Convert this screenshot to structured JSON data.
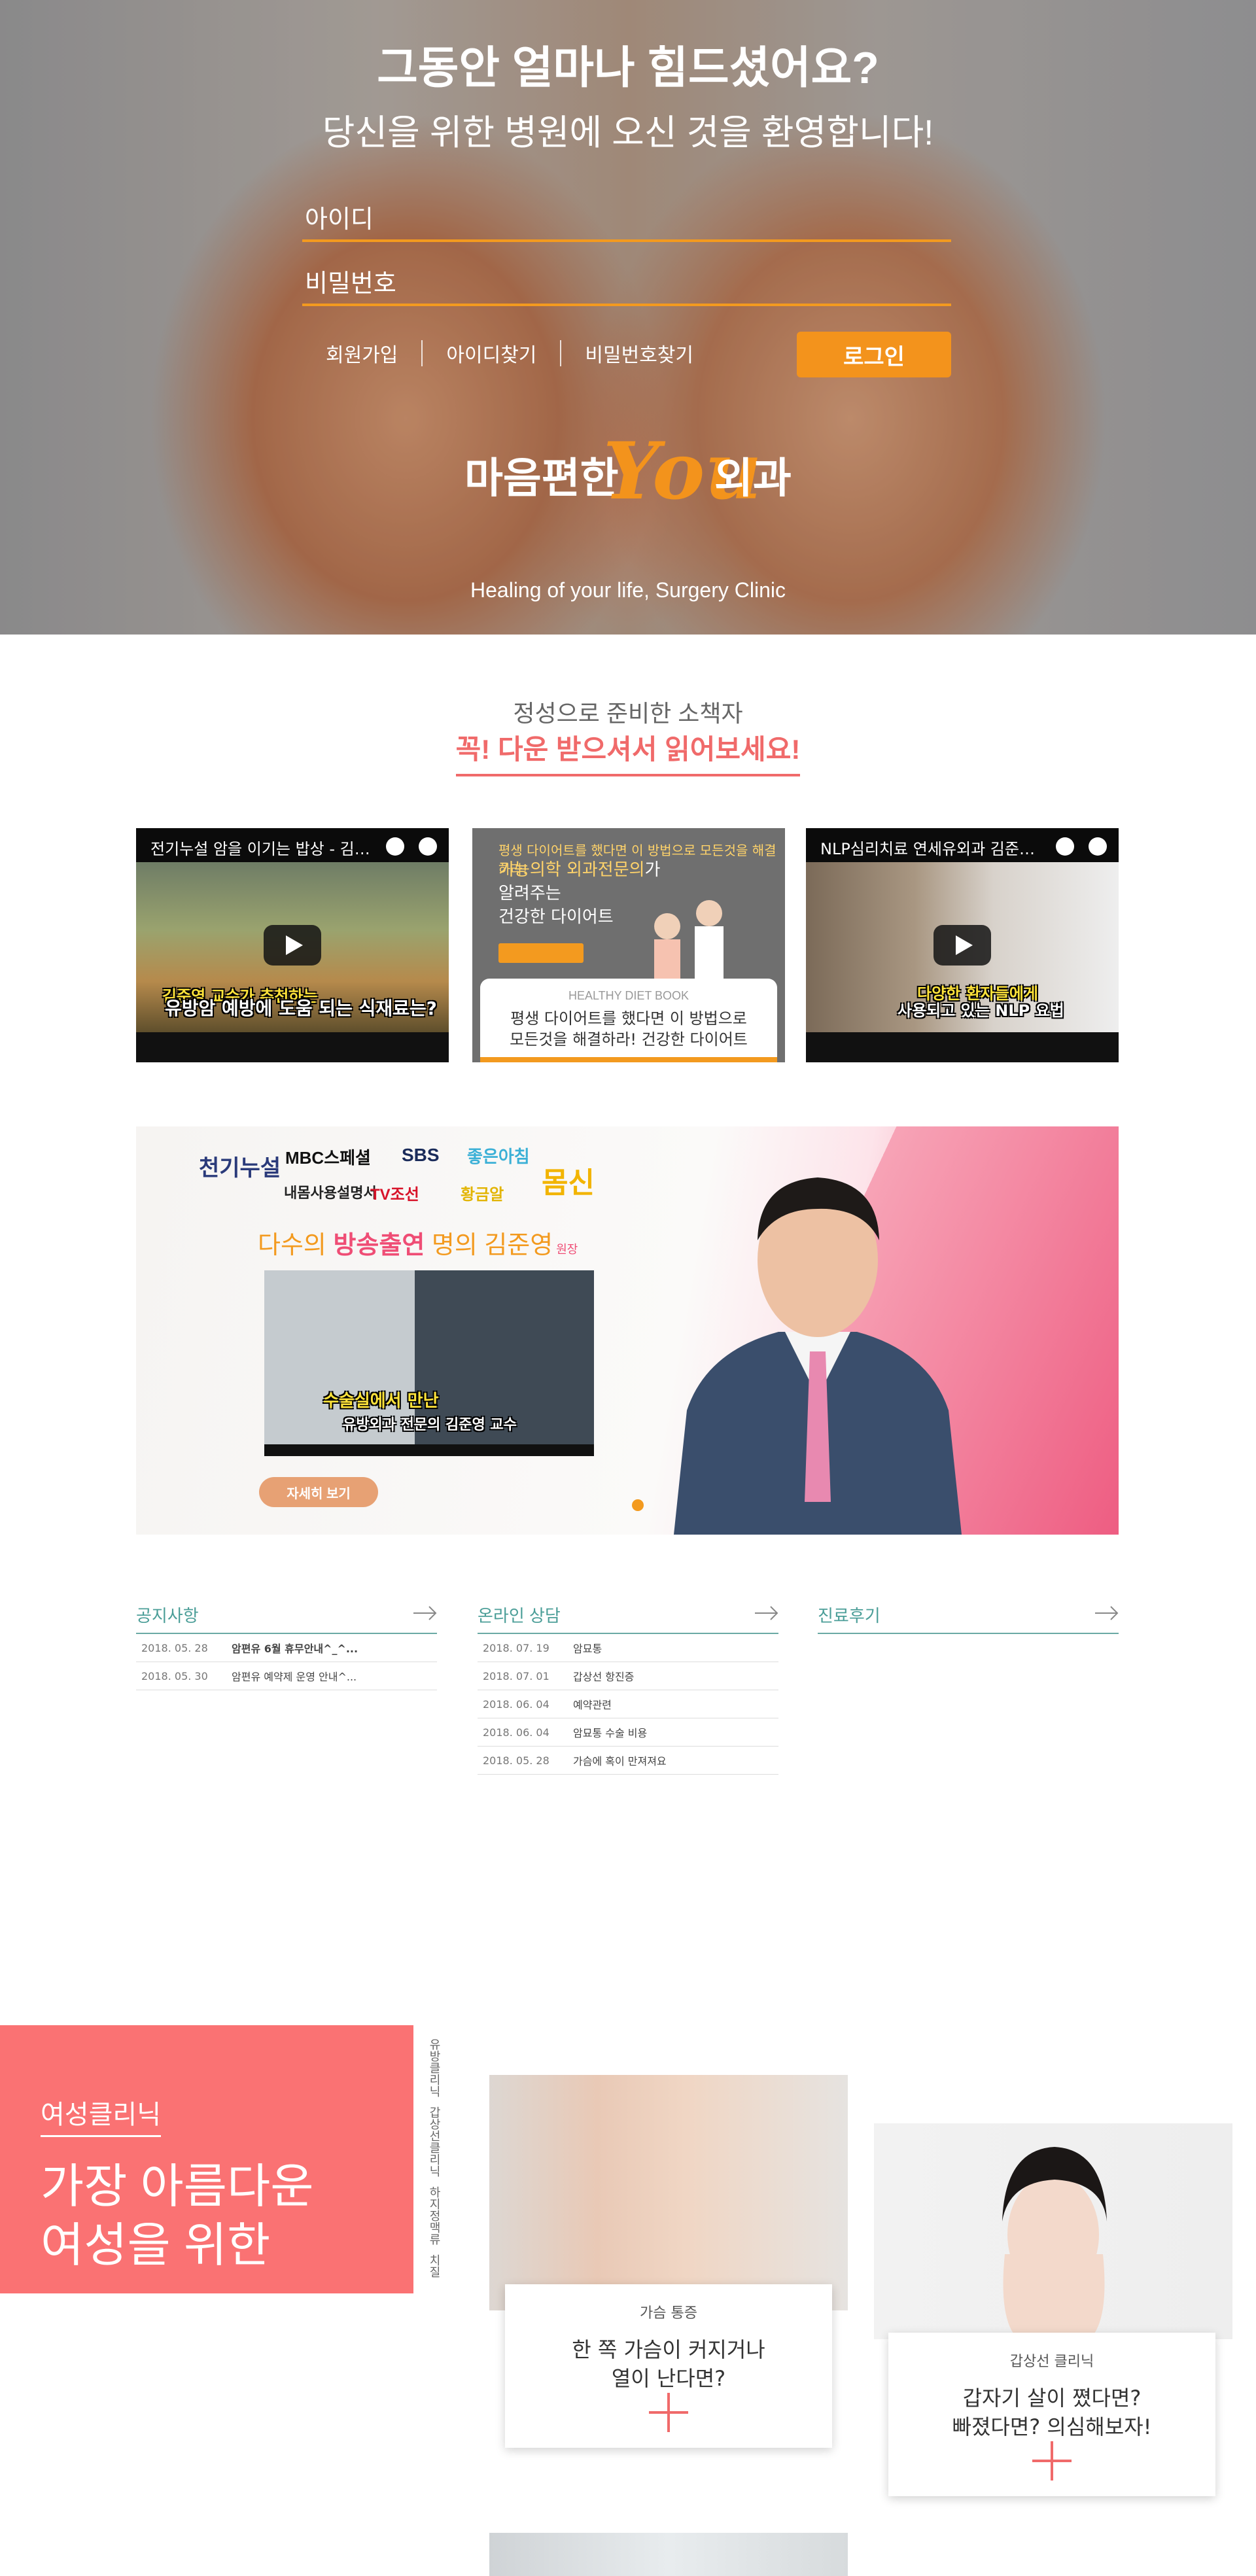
{
  "hero": {
    "title": "그동안 얼마나 힘드셨어요?",
    "subtitle": "당신을 위한 병원에 오신 것을 환영합니다!",
    "id_placeholder": "아이디",
    "pw_placeholder": "비밀번호",
    "links": [
      "회원가입",
      "아이디찾기",
      "비밀번호찾기"
    ],
    "login_label": "로그인",
    "logo": {
      "part1": "마음편한",
      "part2": "You",
      "part3": "외과"
    },
    "tagline": "Healing of your life, Surgery Clinic",
    "accent": "#f3931c"
  },
  "books": {
    "eyebrow": "정성으로 준비한 소책자",
    "title": "꼭! 다운 받으셔서 읽어보세요!",
    "video1": {
      "title": "전기누설 암을 이기는 밥상 - 김준...",
      "caption1": "김준영 교수가 추천하는",
      "caption2": "유방암 예방에 도움 되는 식재료는?"
    },
    "book": {
      "head": "평생 다이어트를 했다면 이 방법으로 모든것을 해결하라!",
      "title1": "기능의학 외과전문의",
      "title1b": "가",
      "title2": "알려주는",
      "title3": "건강한 다이어트",
      "panel_small": "HEALTHY DIET BOOK",
      "panel_line1": "평생 다이어트를 했다면 이 방법으로",
      "panel_line2": "모든것을 해결하라! 건강한 다이어트"
    },
    "video2": {
      "title": "NLP심리치료 연세유외과 김준영...",
      "caption1": "다양한 환자들에게",
      "caption2": "사용되고 있는 NLP 요법"
    }
  },
  "banner": {
    "logos": [
      "천기누설",
      "MBC스페셜",
      "SBS",
      "좋은아침",
      "내몸사용설명서",
      "TV조선",
      "황금알",
      "몸신"
    ],
    "head_a": "다수의 ",
    "head_b": "방송출연",
    "head_c": " 명의 김준영",
    "head_d": " 원장",
    "video_caption1": "수술실에서 만난",
    "video_caption2": "유방외과 전문의 김준영 교수",
    "button": "자세히 보기"
  },
  "boards": {
    "notice": {
      "title": "공지사항",
      "rows": [
        {
          "date": "2018. 05. 28",
          "text": "암편유 6월 휴무안내^_^...",
          "bold": true
        },
        {
          "date": "2018. 05. 30",
          "text": "암편유 예약제 운영 안내^...",
          "bold": false
        }
      ]
    },
    "consult": {
      "title": "온라인 상담",
      "rows": [
        {
          "date": "2018. 07. 19",
          "text": "암묘통"
        },
        {
          "date": "2018. 07. 01",
          "text": "갑상선 항진증"
        },
        {
          "date": "2018. 06. 04",
          "text": "예약관련"
        },
        {
          "date": "2018. 06. 04",
          "text": "암묘통 수술 비용"
        },
        {
          "date": "2018. 05. 28",
          "text": "가슴에 혹이 만져져요"
        }
      ]
    },
    "review": {
      "title": "진료후기"
    }
  },
  "clinic": {
    "tag": "여성클리닉",
    "headline1": "가장 아름다운",
    "headline2": "여성을 위한",
    "vnav": [
      "유방클리닉",
      "갑상선클리닉",
      "하지정맥류",
      "치질"
    ],
    "card1": {
      "small": "가슴 통증",
      "line1": "한 쪽 가슴이 커지거나",
      "line2": "열이 난다면?"
    },
    "card2": {
      "small": "갑상선 클리닉",
      "line1": "갑자기 살이 쪘다면?",
      "line2": "빠졌다면? 의심해보자!"
    }
  }
}
